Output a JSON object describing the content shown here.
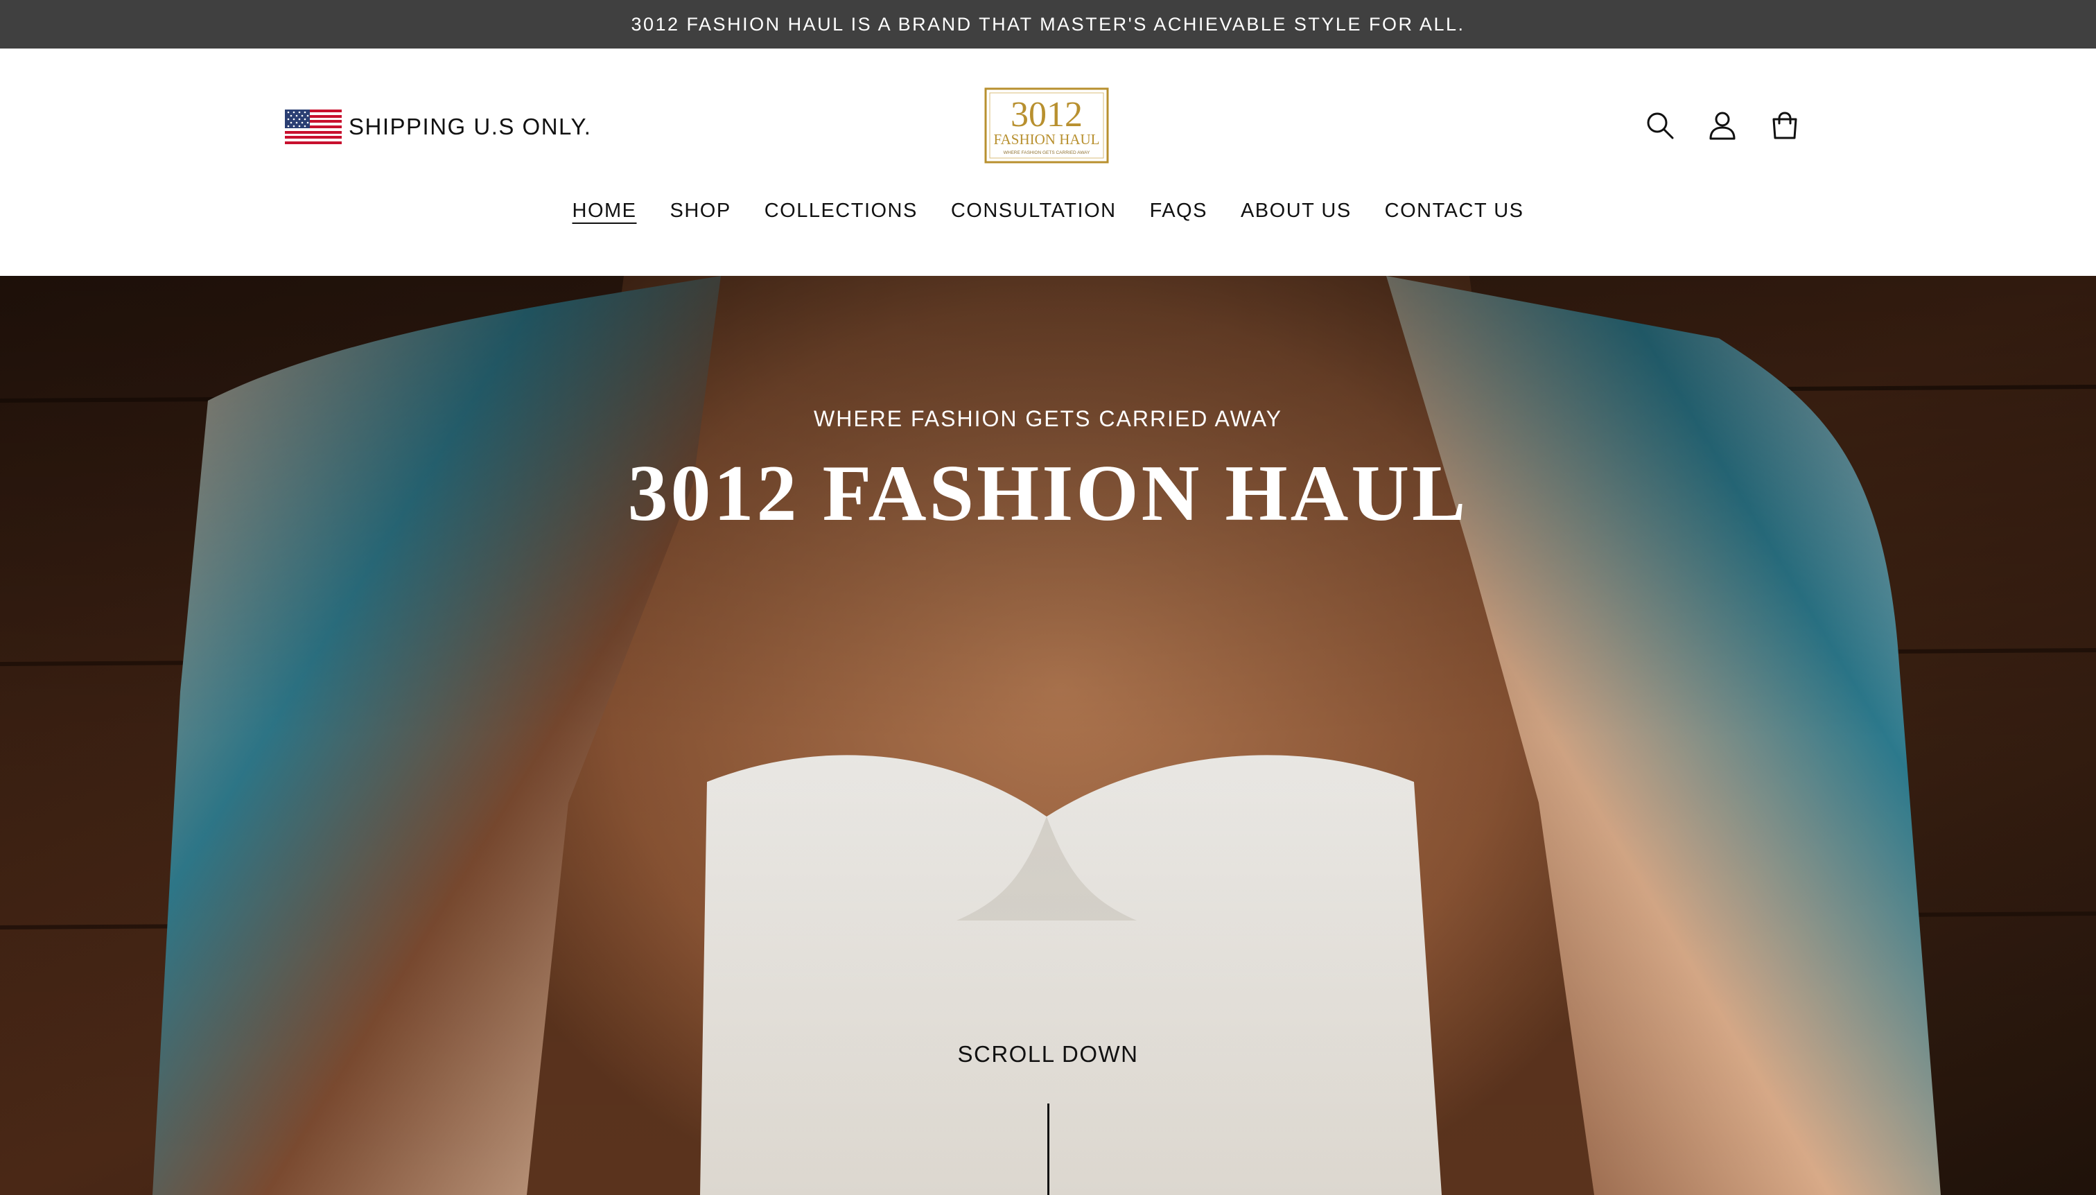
{
  "announcement": {
    "text": "3012 FASHION HAUL IS A BRAND THAT MASTER'S ACHIEVABLE STYLE FOR ALL."
  },
  "header": {
    "shipping": {
      "text": "SHIPPING U.S ONLY.",
      "flag_icon": "us-flag-icon"
    },
    "logo": {
      "number": "3012",
      "name": "FASHION HAUL",
      "tagline": "WHERE FASHION GETS CARRIED AWAY"
    },
    "icons": [
      "search-icon",
      "account-icon",
      "cart-icon"
    ]
  },
  "nav": {
    "items": [
      {
        "label": "HOME",
        "active": true
      },
      {
        "label": "SHOP",
        "active": false
      },
      {
        "label": "COLLECTIONS",
        "active": false
      },
      {
        "label": "CONSULTATION",
        "active": false
      },
      {
        "label": "FAQS",
        "active": false
      },
      {
        "label": "ABOUT US",
        "active": false
      },
      {
        "label": "CONTACT US",
        "active": false
      }
    ]
  },
  "hero": {
    "subheading": "WHERE FASHION GETS CARRIED AWAY",
    "heading": "3012 FASHION HAUL",
    "scroll_label": "SCROLL DOWN"
  },
  "colors": {
    "announcement_bg": "#404040",
    "text": "#111111",
    "logo_gold": "#b8902f",
    "hero_overlay_text": "#ffffff"
  }
}
